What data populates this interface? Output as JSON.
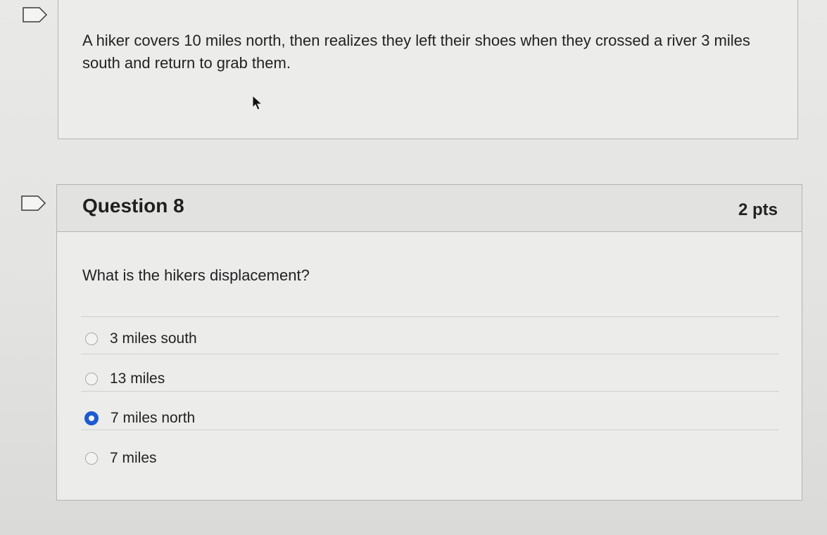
{
  "previous_question": {
    "text": "A hiker covers 10 miles north, then realizes they left their shoes when they crossed a river 3 miles south and return to grab them."
  },
  "question": {
    "title": "Question 8",
    "points": "2 pts",
    "prompt": "What is the hikers displacement?",
    "answers": [
      {
        "label": "3 miles south",
        "selected": false
      },
      {
        "label": "13 miles",
        "selected": false
      },
      {
        "label": "7 miles north",
        "selected": true
      },
      {
        "label": "7 miles",
        "selected": false
      }
    ]
  },
  "colors": {
    "selected_radio": "#1a5bd6",
    "text": "#222222"
  },
  "icons": {
    "flag": "bookmark-flag-icon",
    "cursor": "mouse-pointer-icon"
  }
}
